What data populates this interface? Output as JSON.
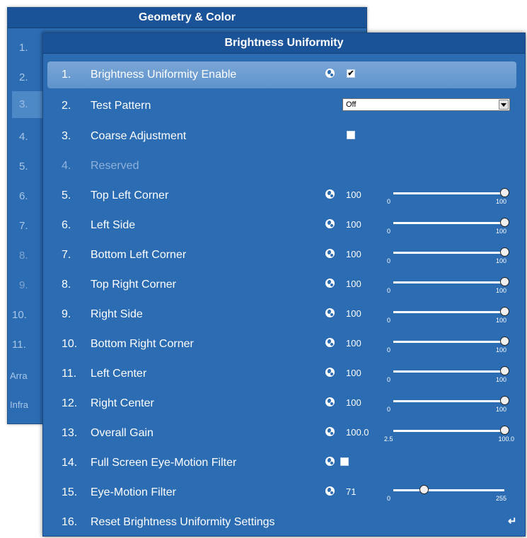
{
  "geometry_panel": {
    "title": "Geometry & Color",
    "numbers": [
      "1.",
      "2.",
      "3.",
      "4.",
      "5.",
      "6.",
      "7.",
      "8.",
      "9.",
      "10.",
      "11."
    ],
    "extra_items": [
      "Arra",
      "Infra"
    ]
  },
  "uniformity_panel": {
    "title": "Brightness Uniformity",
    "items": [
      {
        "num": "1.",
        "label": "Brightness Uniformity Enable",
        "checked": "✔"
      },
      {
        "num": "2.",
        "label": "Test Pattern",
        "dropdown_value": "Off"
      },
      {
        "num": "3.",
        "label": "Coarse Adjustment"
      },
      {
        "num": "4.",
        "label": "Reserved"
      },
      {
        "num": "5.",
        "label": "Top Left Corner",
        "value": "100",
        "min": "0",
        "max": "100",
        "level": 1.0
      },
      {
        "num": "6.",
        "label": "Left Side",
        "value": "100",
        "min": "0",
        "max": "100",
        "level": 1.0
      },
      {
        "num": "7.",
        "label": "Bottom Left Corner",
        "value": "100",
        "min": "0",
        "max": "100",
        "level": 1.0
      },
      {
        "num": "8.",
        "label": "Top Right Corner",
        "value": "100",
        "min": "0",
        "max": "100",
        "level": 1.0
      },
      {
        "num": "9.",
        "label": "Right Side",
        "value": "100",
        "min": "0",
        "max": "100",
        "level": 1.0
      },
      {
        "num": "10.",
        "label": "Bottom Right Corner",
        "value": "100",
        "min": "0",
        "max": "100",
        "level": 1.0
      },
      {
        "num": "11.",
        "label": "Left Center",
        "value": "100",
        "min": "0",
        "max": "100",
        "level": 1.0
      },
      {
        "num": "12.",
        "label": "Right Center",
        "value": "100",
        "min": "0",
        "max": "100",
        "level": 1.0
      },
      {
        "num": "13.",
        "label": "Overall Gain",
        "value": "100.0",
        "min": "2.5",
        "max": "100.0",
        "level": 1.0
      },
      {
        "num": "14.",
        "label": "Full Screen Eye-Motion Filter"
      },
      {
        "num": "15.",
        "label": "Eye-Motion Filter",
        "value": "71",
        "min": "0",
        "max": "255",
        "level": 0.278
      },
      {
        "num": "16.",
        "label": "Reset Brightness Uniformity Settings"
      }
    ]
  },
  "colors": {
    "panel_bg": "#2b6cb3",
    "header_bg": "#1b5399",
    "selected_row": "#6d9dd1"
  },
  "icons": [
    "globe-icon",
    "enter-icon",
    "dropdown-arrow-icon",
    "checkbox-icon"
  ]
}
